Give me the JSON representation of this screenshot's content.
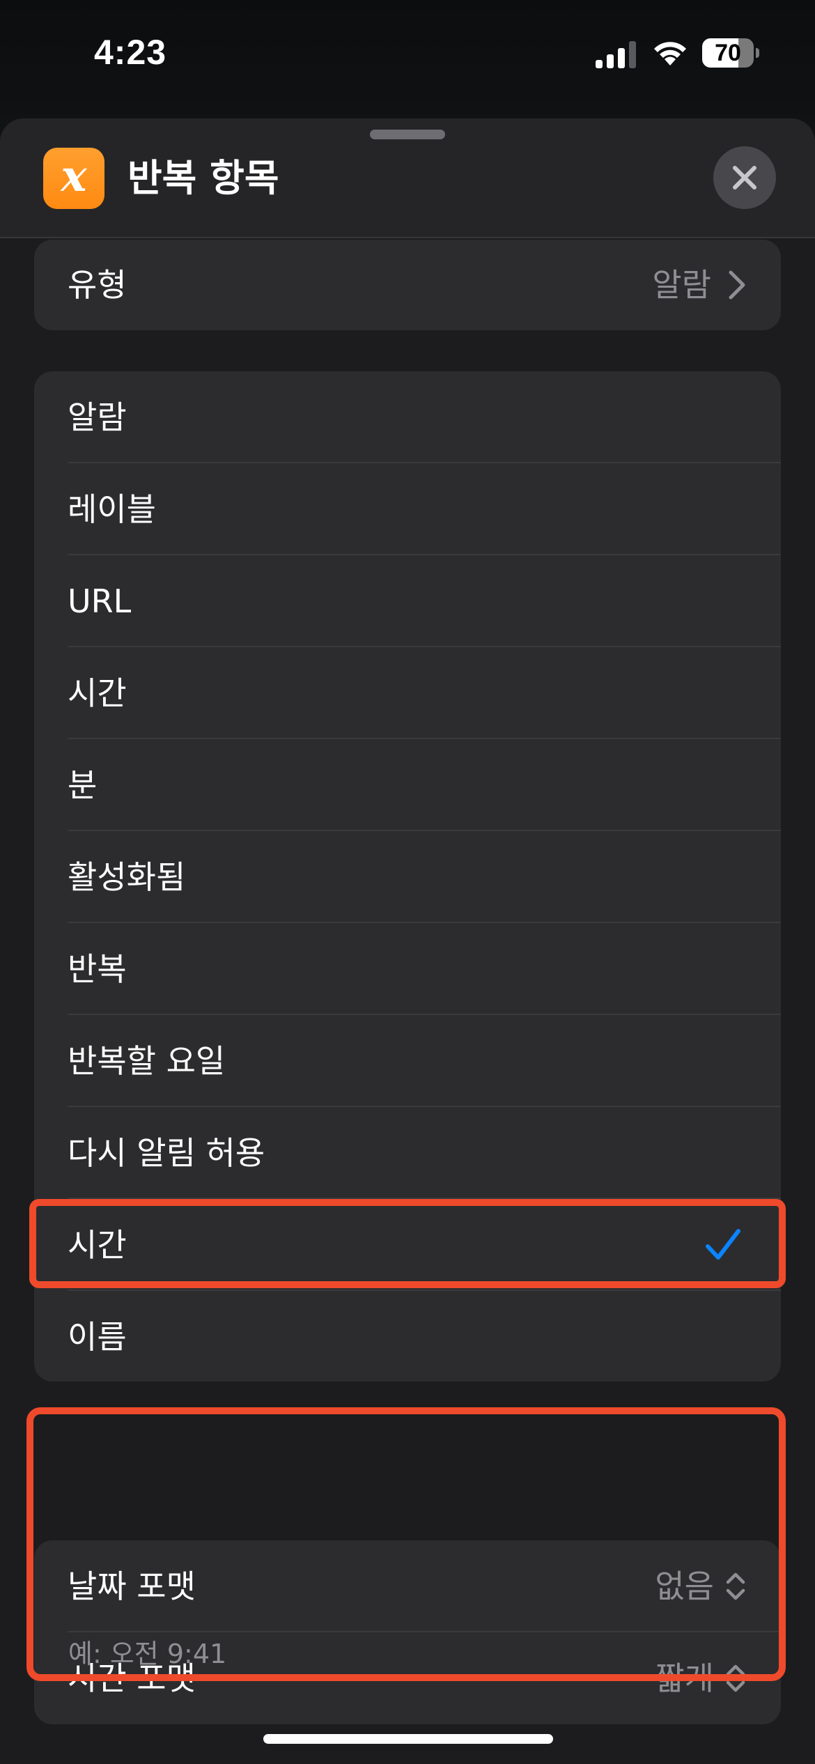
{
  "status_bar": {
    "time": "4:23",
    "battery_level": "70",
    "battery_fraction": 0.7
  },
  "sheet": {
    "title": "반복 항목",
    "app_icon_glyph": "x",
    "app_icon_color": "#ff9500",
    "close_icon": "close-icon"
  },
  "type_row": {
    "label": "유형",
    "value": "알람"
  },
  "list": {
    "items": [
      {
        "label": "알람"
      },
      {
        "label": "레이블"
      },
      {
        "label": "URL"
      },
      {
        "label": "시간"
      },
      {
        "label": "분"
      },
      {
        "label": "활성화됨"
      },
      {
        "label": "반복"
      },
      {
        "label": "반복할 요일"
      },
      {
        "label": "다시 알림 허용"
      },
      {
        "label": "시간",
        "selected": true
      },
      {
        "label": "이름"
      }
    ],
    "check_color": "#0a84ff"
  },
  "format": {
    "date_format_label": "날짜 포맷",
    "date_format_value": "없음",
    "time_format_label": "시간 포맷",
    "time_format_value": "짧게",
    "example": "예: 오전 9:41"
  },
  "annotation_color": "#ef4a2b"
}
